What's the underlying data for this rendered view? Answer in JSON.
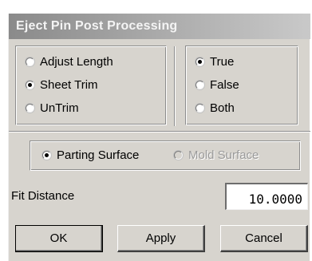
{
  "dialog": {
    "title": "Eject Pin Post Processing"
  },
  "trim_options": [
    {
      "label": "Adjust Length",
      "checked": false
    },
    {
      "label": "Sheet Trim",
      "checked": true
    },
    {
      "label": "UnTrim",
      "checked": false
    }
  ],
  "bool_options": [
    {
      "label": "True",
      "checked": true
    },
    {
      "label": "False",
      "checked": false
    },
    {
      "label": "Both",
      "checked": false
    }
  ],
  "surface_options": [
    {
      "label": "Parting Surface",
      "checked": true,
      "enabled": true
    },
    {
      "label": "Mold Surface",
      "checked": false,
      "enabled": false
    }
  ],
  "fit_distance": {
    "label": "Fit Distance",
    "value": "10.0000"
  },
  "buttons": {
    "ok": "OK",
    "apply": "Apply",
    "cancel": "Cancel"
  }
}
